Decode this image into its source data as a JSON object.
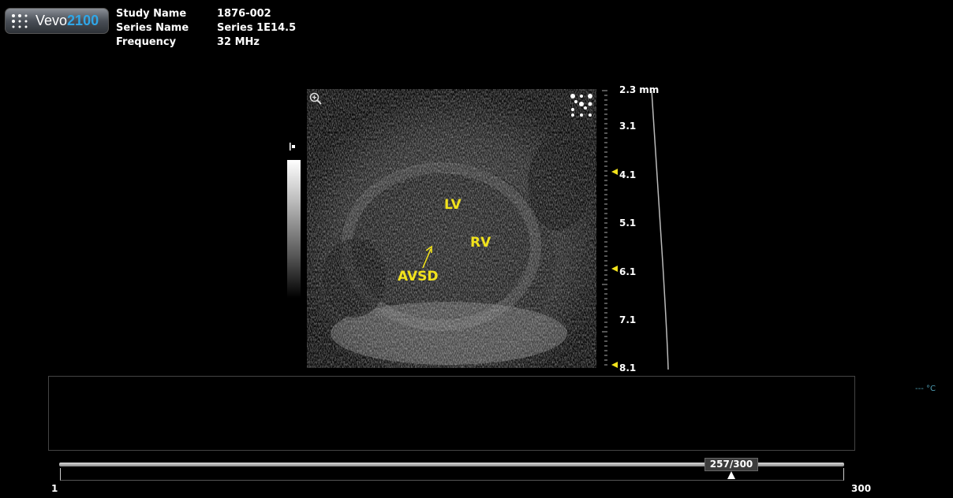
{
  "logo": {
    "brand": "Vevo",
    "model": "2100"
  },
  "study": {
    "rows": [
      {
        "label": "Study Name",
        "value": "1876-002"
      },
      {
        "label": "Series Name",
        "value": "Series 1E14.5"
      },
      {
        "label": "Frequency",
        "value": "32 MHz"
      }
    ]
  },
  "image": {
    "annotations": {
      "lv": "LV",
      "rv": "RV",
      "avsd": "AVSD"
    },
    "depth_labels": [
      "2.3",
      "3.1",
      "4.1",
      "5.1",
      "6.1",
      "7.1",
      "8.1"
    ],
    "depth_unit": "mm",
    "accent": "#f1e21c"
  },
  "status": {
    "temperature": "--- °C"
  },
  "timeline": {
    "current": 257,
    "total": 300,
    "frame_label": "257/300",
    "start_label": "1",
    "end_label": "300"
  },
  "icons": {
    "zoom": "zoom-in-icon",
    "probe": "probe-orientation-icon"
  }
}
